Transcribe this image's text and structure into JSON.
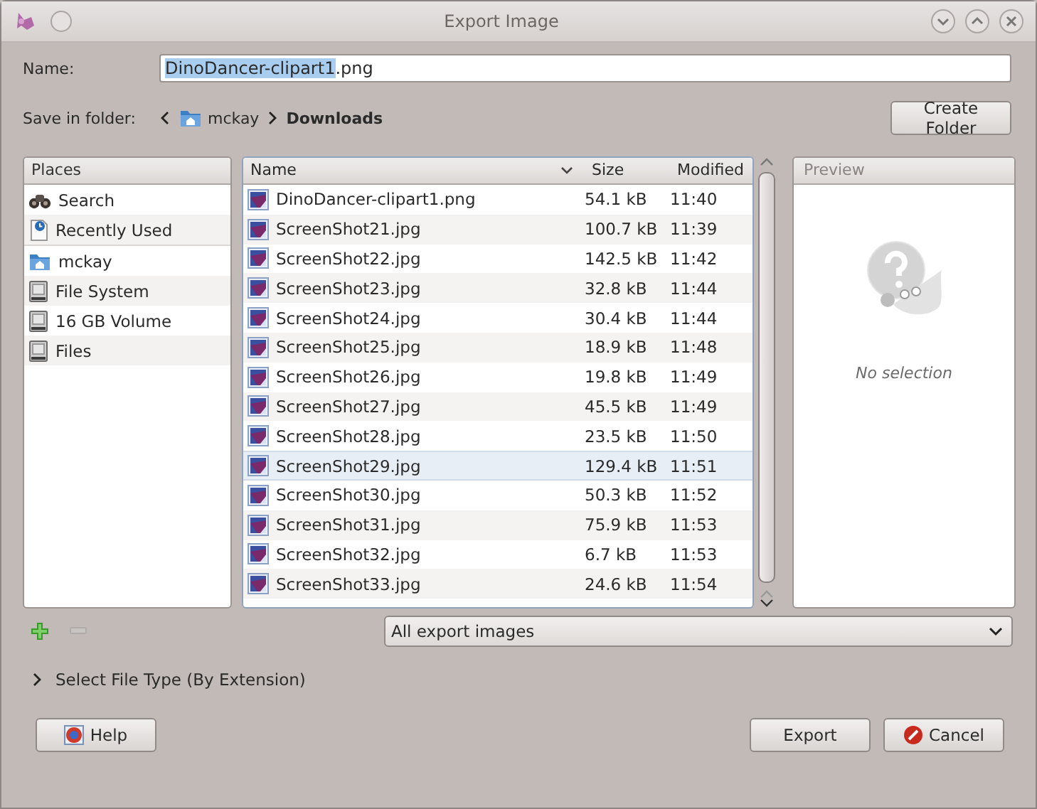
{
  "window": {
    "title": "Export Image"
  },
  "name_field": {
    "label": "Name:",
    "selected_text": "DinoDancer-clipart1",
    "rest_text": ".png"
  },
  "folder": {
    "label": "Save in folder:",
    "path": [
      {
        "label": "mckay",
        "kind": "home",
        "current": false
      },
      {
        "label": "Downloads",
        "kind": "plain",
        "current": true
      }
    ]
  },
  "create_folder_button": "Create Folder",
  "places": {
    "heading": "Places",
    "items": [
      {
        "label": "Search",
        "kind": "search",
        "group_end": false
      },
      {
        "label": "Recently Used",
        "kind": "recent",
        "group_end": true
      },
      {
        "label": "mckay",
        "kind": "home",
        "group_end": false
      },
      {
        "label": "File System",
        "kind": "drive",
        "group_end": false
      },
      {
        "label": "16 GB Volume",
        "kind": "drive",
        "group_end": false
      },
      {
        "label": "Files",
        "kind": "drive",
        "group_end": false
      }
    ]
  },
  "files": {
    "columns": [
      "Name",
      "Size",
      "Modified"
    ],
    "rows": [
      {
        "name": "DinoDancer-clipart1.png",
        "size": "54.1 kB",
        "modified": "11:40",
        "hovered": false
      },
      {
        "name": "ScreenShot21.jpg",
        "size": "100.7 kB",
        "modified": "11:39",
        "hovered": false
      },
      {
        "name": "ScreenShot22.jpg",
        "size": "142.5 kB",
        "modified": "11:42",
        "hovered": false
      },
      {
        "name": "ScreenShot23.jpg",
        "size": "32.8 kB",
        "modified": "11:44",
        "hovered": false
      },
      {
        "name": "ScreenShot24.jpg",
        "size": "30.4 kB",
        "modified": "11:44",
        "hovered": false
      },
      {
        "name": "ScreenShot25.jpg",
        "size": "18.9 kB",
        "modified": "11:48",
        "hovered": false
      },
      {
        "name": "ScreenShot26.jpg",
        "size": "19.8 kB",
        "modified": "11:49",
        "hovered": false
      },
      {
        "name": "ScreenShot27.jpg",
        "size": "45.5 kB",
        "modified": "11:49",
        "hovered": false
      },
      {
        "name": "ScreenShot28.jpg",
        "size": "23.5 kB",
        "modified": "11:50",
        "hovered": false
      },
      {
        "name": "ScreenShot29.jpg",
        "size": "129.4 kB",
        "modified": "11:51",
        "hovered": true
      },
      {
        "name": "ScreenShot30.jpg",
        "size": "50.3 kB",
        "modified": "11:52",
        "hovered": false
      },
      {
        "name": "ScreenShot31.jpg",
        "size": "75.9 kB",
        "modified": "11:53",
        "hovered": false
      },
      {
        "name": "ScreenShot32.jpg",
        "size": "6.7 kB",
        "modified": "11:53",
        "hovered": false
      },
      {
        "name": "ScreenShot33.jpg",
        "size": "24.6 kB",
        "modified": "11:54",
        "hovered": false
      }
    ]
  },
  "preview": {
    "heading": "Preview",
    "message": "No selection"
  },
  "filter": {
    "value": "All export images"
  },
  "file_type_expander": {
    "label": "Select File Type (By Extension)",
    "expanded": false
  },
  "buttons": [
    {
      "label": "Help",
      "kind": "help"
    },
    {
      "label": "Export",
      "kind": "export"
    },
    {
      "label": "Cancel",
      "kind": "cancel"
    }
  ]
}
